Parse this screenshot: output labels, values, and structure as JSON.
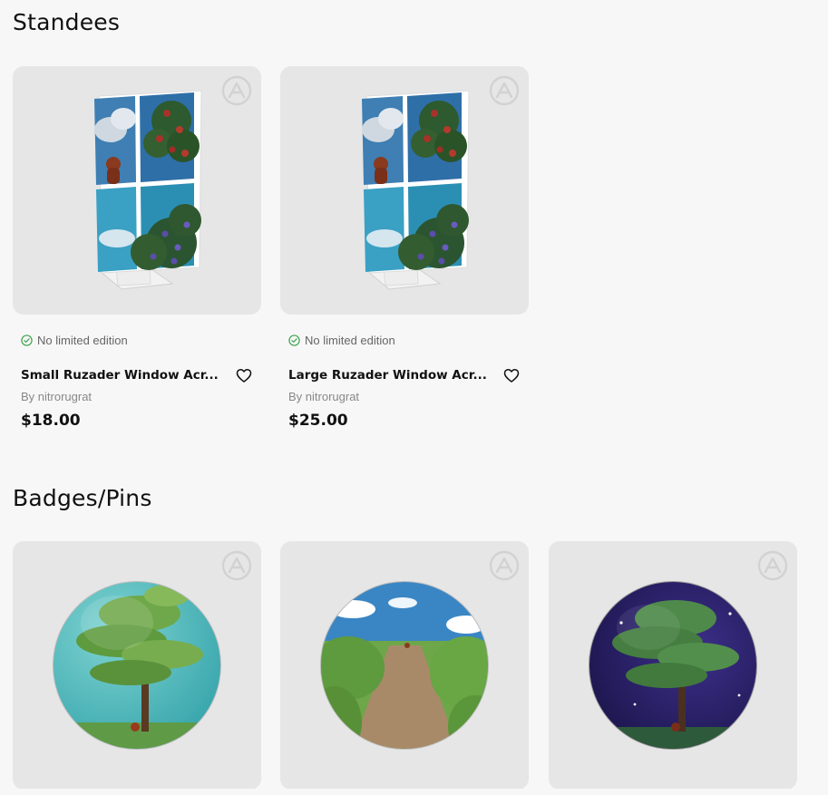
{
  "sections": {
    "standees": {
      "title": "Standees",
      "products": [
        {
          "edition": "No limited edition",
          "title": "Small Ruzader Window Acr...",
          "author": "By nitrorugrat",
          "price": "$18.00"
        },
        {
          "edition": "No limited edition",
          "title": "Large Ruzader Window Acr...",
          "author": "By nitrorugrat",
          "price": "$25.00"
        }
      ]
    },
    "badges": {
      "title": "Badges/Pins"
    }
  },
  "colors": {
    "page_bg": "#f7f7f7",
    "card_bg": "#e6e6e6",
    "check_green": "#3fa34d"
  },
  "icons": [
    "logo-watermark-icon",
    "check-circle-icon",
    "heart-icon"
  ]
}
